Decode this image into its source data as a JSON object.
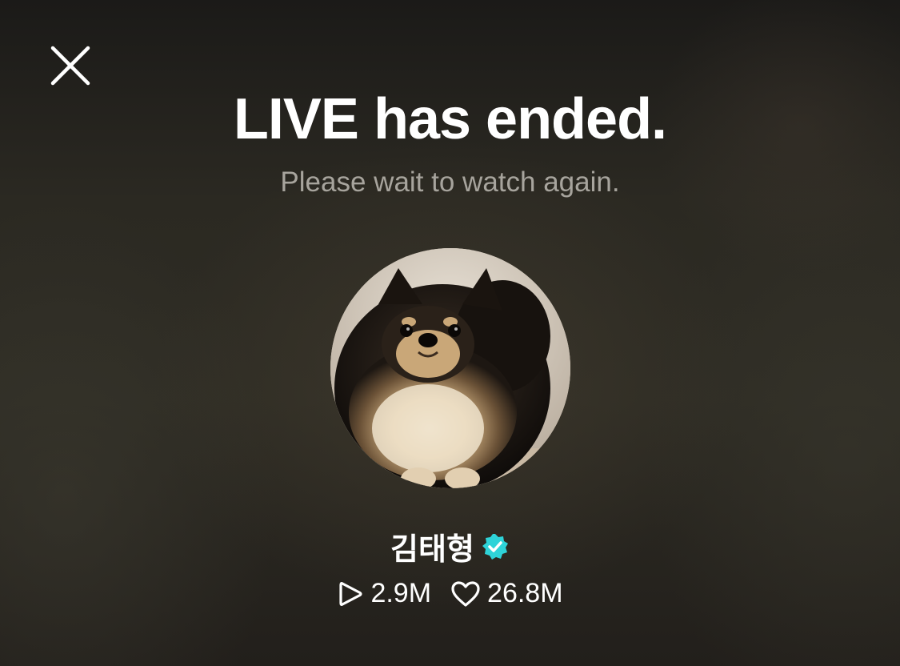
{
  "page": {
    "title": "LIVE has ended.",
    "subtitle": "Please wait to watch again."
  },
  "icons": {
    "close": "close-icon",
    "verified": "verified-badge-icon",
    "views": "play-icon",
    "likes": "heart-icon"
  },
  "profile": {
    "name": "김태형",
    "verified": true,
    "avatar": "pomeranian-dog-photo"
  },
  "stats": {
    "views": "2.9M",
    "likes": "26.8M"
  },
  "colors": {
    "title": "#ffffff",
    "subtitle": "#a7a49d",
    "verified": "#2ed3d8",
    "background": "#2b2922"
  }
}
